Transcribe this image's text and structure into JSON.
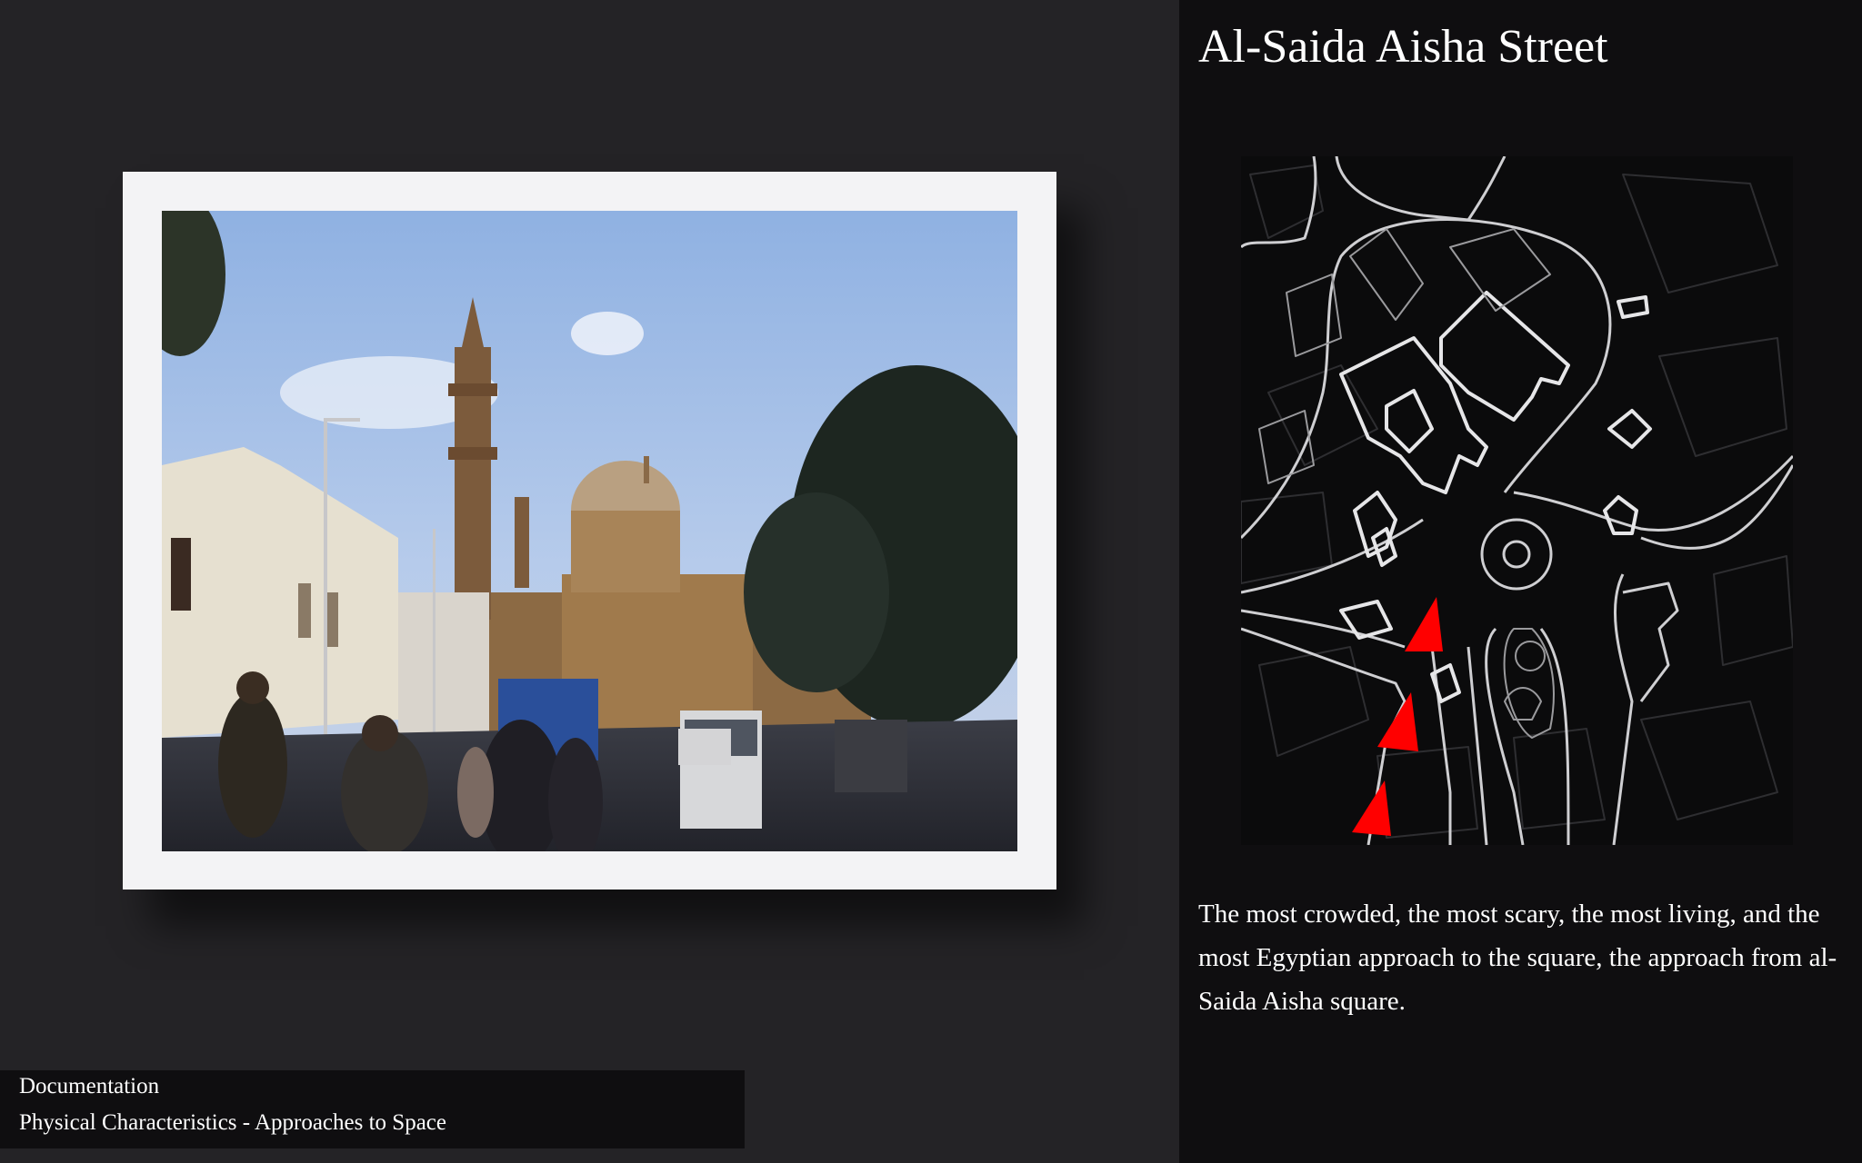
{
  "slide": {
    "title": "Al-Saida Aisha Street",
    "description": "The most crowded, the most scary, the most living, and the most Egyptian approach to the square, the approach from al-Saida Aisha square.",
    "photo_label": "Street view photo",
    "map_label": "Street map with approach arrows"
  },
  "footer": {
    "section": "Documentation",
    "subsection": "Physical Characteristics - Approaches to Space"
  },
  "colors": {
    "background": "#242326",
    "panel": "#0f0e10",
    "arrow": "#ff0000"
  }
}
